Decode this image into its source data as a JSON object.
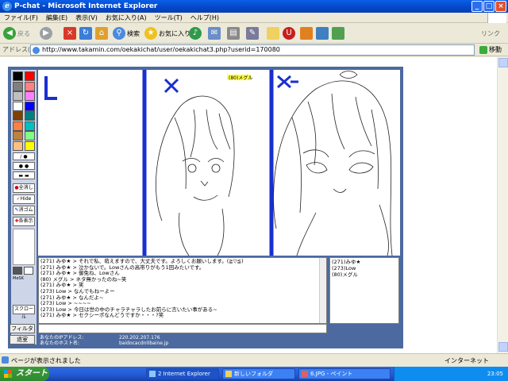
{
  "window": {
    "title": "P-chat - Microsoft Internet Explorer"
  },
  "menu": [
    "ファイル(F)",
    "編集(E)",
    "表示(V)",
    "お気に入り(A)",
    "ツール(T)",
    "ヘルプ(H)"
  ],
  "toolbar": {
    "back": "戻る",
    "search": "検索",
    "favorites": "お気に入り",
    "links": "リンク"
  },
  "address": {
    "label": "アドレス(D)",
    "url": "http://www.takamin.com/oekakichat/user/oekakichat3.php?userid=170080",
    "go": "移動"
  },
  "app": {
    "canvas_badge": "(80)メグル",
    "tools": {
      "fill": "全消し",
      "hide": "Hide",
      "eraser": "消ゴム",
      "grid": "各表示",
      "msg": "MeSK",
      "scroll": "スクロール"
    },
    "chat": [
      "(271) みゆ★ > それで私、萌えますので、大丈夫です。よろしくお願いします。(≧▽≦)",
      "(271) みゆ★ > 泣かないで。Lowさんの高帯りがもう1回みたいです。",
      "(271) みゆ★ > 御免ね、Lowさん",
      "(80) メグル > ネタ無かったのね~笑",
      "(271) みゆ★ > 笑",
      "(273) Low > なんでもねーよー",
      "(271) みゆ★ > なんだよ~",
      "(273) Low > ~~~~",
      "(273) Low > 今日は世の中のチャラチャラしたお前らに言いたい事がある~",
      "(271) みゆ★ > セクシーポなんどうですか・・・?笑"
    ],
    "users": [
      "(271)みゆ★",
      "(273)Low",
      "(80)メグル"
    ],
    "filter_label": "フィルタ",
    "exit_label": "退室",
    "info": {
      "ip_label": "あなたのIPアドレス:",
      "ip_value": "220.202.207.176",
      "host_label": "あなたのホスト名:",
      "host_value": "baidocacdn0baine.jp"
    }
  },
  "status": {
    "text": "ページが表示されました",
    "zone": "インターネット"
  },
  "taskbar": {
    "start": "スタート",
    "tasks": [
      "2 Internet Explorer",
      "新しいフォルダ",
      "6.JPG - ペイント"
    ],
    "clock": "23:05"
  },
  "colors": {
    "accent": "#0a5ee8",
    "app_bg": "#4c6a9f",
    "drawing_blue": "#1a2fd0"
  },
  "palette": [
    "#000000",
    "#ff0000",
    "#808080",
    "#ff8080",
    "#c0c0c0",
    "#ff80ff",
    "#ffffff",
    "#0000ff",
    "#804000",
    "#008080",
    "#ff8040",
    "#00c0c0",
    "#c08040",
    "#80ff80",
    "#ffc080",
    "#ffff00"
  ]
}
